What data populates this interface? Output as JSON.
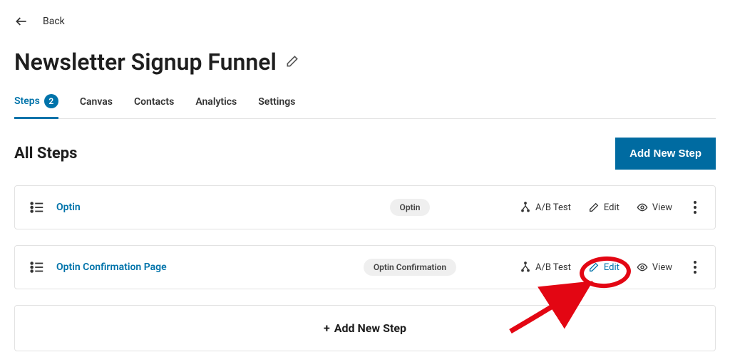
{
  "back": {
    "label": "Back"
  },
  "title": "Newsletter Signup Funnel",
  "tabs": {
    "steps": {
      "label": "Steps",
      "count": "2"
    },
    "canvas": {
      "label": "Canvas"
    },
    "contacts": {
      "label": "Contacts"
    },
    "analytics": {
      "label": "Analytics"
    },
    "settings": {
      "label": "Settings"
    }
  },
  "section": {
    "title": "All Steps",
    "add_button": "Add New Step",
    "add_bar": "Add New Step"
  },
  "actions": {
    "abtest": "A/B Test",
    "edit": "Edit",
    "view": "View"
  },
  "steps": [
    {
      "name": "Optin",
      "type": "Optin"
    },
    {
      "name": "Optin Confirmation Page",
      "type": "Optin Confirmation"
    }
  ]
}
